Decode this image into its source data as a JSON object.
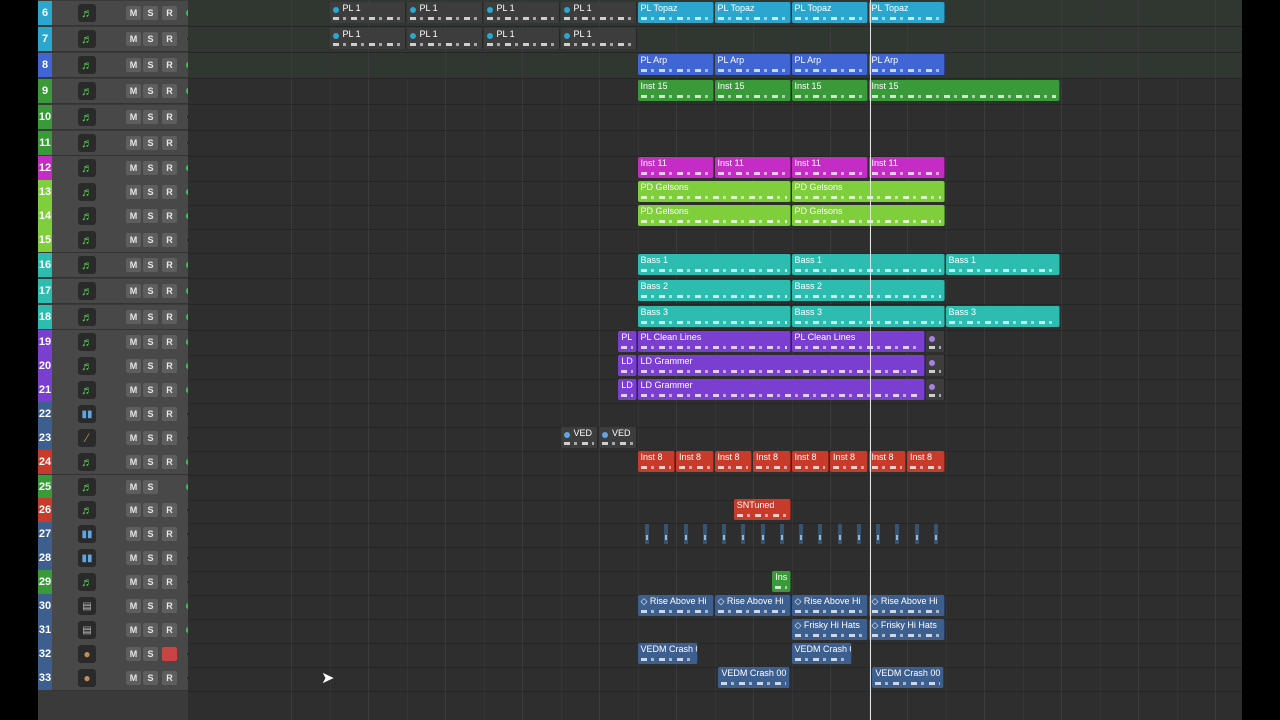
{
  "tracks": [
    {
      "num": "6",
      "color": "#2aa6cf",
      "icon": "music-note-icon",
      "glyph": "♬",
      "m": "M",
      "s": "S",
      "r": "R",
      "led": true
    },
    {
      "num": "7",
      "color": "#2aa6cf",
      "icon": "music-note-icon",
      "glyph": "♬",
      "m": "M",
      "s": "S",
      "r": "R",
      "led": false
    },
    {
      "num": "8",
      "color": "#3f66d4",
      "icon": "music-note-icon",
      "glyph": "♬",
      "m": "M",
      "s": "S",
      "r": "R",
      "led": true
    },
    {
      "num": "9",
      "color": "#3a9a3a",
      "icon": "music-note-icon",
      "glyph": "♬",
      "m": "M",
      "s": "S",
      "r": "R",
      "led": true
    },
    {
      "num": "10",
      "color": "#3a9a3a",
      "icon": "music-note-icon",
      "glyph": "♬",
      "m": "M",
      "s": "S",
      "r": "R",
      "led": false
    },
    {
      "num": "11",
      "color": "#3a9a3a",
      "icon": "music-note-icon",
      "glyph": "♬",
      "m": "M",
      "s": "S",
      "r": "R",
      "led": false
    },
    {
      "num": "12",
      "color": "#c52bc5",
      "icon": "music-note-icon",
      "glyph": "♬",
      "m": "M",
      "s": "S",
      "r": "R",
      "led": true
    },
    {
      "num": "13",
      "color": "#7fcf3c",
      "icon": "music-note-icon",
      "glyph": "♬",
      "m": "M",
      "s": "S",
      "r": "R",
      "led": true
    },
    {
      "num": "14",
      "color": "#7fcf3c",
      "icon": "music-note-icon",
      "glyph": "♬",
      "m": "M",
      "s": "S",
      "r": "R",
      "led": true
    },
    {
      "num": "15",
      "color": "#7fcf3c",
      "icon": "music-note-icon",
      "glyph": "♬",
      "m": "M",
      "s": "S",
      "r": "R",
      "led": false
    },
    {
      "num": "16",
      "color": "#2dbdb0",
      "icon": "music-note-icon",
      "glyph": "♬",
      "m": "M",
      "s": "S",
      "r": "R",
      "led": true
    },
    {
      "num": "17",
      "color": "#2dbdb0",
      "icon": "music-note-icon",
      "glyph": "♬",
      "m": "M",
      "s": "S",
      "r": "R",
      "led": true
    },
    {
      "num": "18",
      "color": "#2dbdb0",
      "icon": "music-note-icon",
      "glyph": "♬",
      "m": "M",
      "s": "S",
      "r": "R",
      "led": true
    },
    {
      "num": "19",
      "color": "#7a3fd1",
      "icon": "music-note-icon",
      "glyph": "♬",
      "m": "M",
      "s": "S",
      "r": "R",
      "led": true
    },
    {
      "num": "20",
      "color": "#7a3fd1",
      "icon": "music-note-icon",
      "glyph": "♬",
      "m": "M",
      "s": "S",
      "r": "R",
      "led": true
    },
    {
      "num": "21",
      "color": "#7a3fd1",
      "icon": "music-note-icon",
      "glyph": "♬",
      "m": "M",
      "s": "S",
      "r": "R",
      "led": true
    },
    {
      "num": "22",
      "color": "#3d5f8f",
      "icon": "waveform-icon",
      "glyph": "▮▮",
      "m": "M",
      "s": "S",
      "r": "R",
      "led": false
    },
    {
      "num": "23",
      "color": "#3d5f8f",
      "icon": "drumstick-icon",
      "glyph": "⁄",
      "m": "M",
      "s": "S",
      "r": "R",
      "led": false
    },
    {
      "num": "24",
      "color": "#c83a2a",
      "icon": "music-note-icon",
      "glyph": "♬",
      "m": "M",
      "s": "S",
      "r": "R",
      "led": true
    },
    {
      "num": "25",
      "color": "#3a9a3a",
      "icon": "music-note-icon",
      "glyph": "♬",
      "m": "M",
      "s": "S",
      "r": "",
      "led": true
    },
    {
      "num": "26",
      "color": "#c83a2a",
      "icon": "music-note-icon",
      "glyph": "♬",
      "m": "M",
      "s": "S",
      "r": "R",
      "led": false
    },
    {
      "num": "27",
      "color": "#3d5f8f",
      "icon": "waveform-icon",
      "glyph": "▮▮",
      "m": "M",
      "s": "S",
      "r": "R",
      "led": false
    },
    {
      "num": "28",
      "color": "#3d5f8f",
      "icon": "waveform-icon",
      "glyph": "▮▮",
      "m": "M",
      "s": "S",
      "r": "R",
      "led": false
    },
    {
      "num": "29",
      "color": "#3a9a3a",
      "icon": "music-note-icon",
      "glyph": "♬",
      "m": "M",
      "s": "S",
      "r": "R",
      "led": false
    },
    {
      "num": "30",
      "color": "#3d5f8f",
      "icon": "folder-icon",
      "glyph": "▤",
      "m": "M",
      "s": "S",
      "r": "R",
      "led": true
    },
    {
      "num": "31",
      "color": "#3d5f8f",
      "icon": "folder-icon",
      "glyph": "▤",
      "m": "M",
      "s": "S",
      "r": "R",
      "led": true
    },
    {
      "num": "32",
      "color": "#3d5f8f",
      "icon": "microphone-icon",
      "glyph": "●",
      "m": "M",
      "s": "S",
      "r": "R",
      "led": false,
      "armed": true
    },
    {
      "num": "33",
      "color": "#3d5f8f",
      "icon": "microphone-icon",
      "glyph": "●",
      "m": "M",
      "s": "S",
      "r": "R",
      "led": false
    }
  ],
  "regions": [
    {
      "track": 0,
      "bar": 1.5,
      "len": 1,
      "label": "PL 1",
      "color": "#3d3d3d",
      "dot": "#2aa6cf"
    },
    {
      "track": 0,
      "bar": 2.5,
      "len": 1,
      "label": "PL 1",
      "color": "#3d3d3d",
      "dot": "#2aa6cf"
    },
    {
      "track": 0,
      "bar": 3.5,
      "len": 1,
      "label": "PL 1",
      "color": "#3d3d3d",
      "dot": "#2aa6cf"
    },
    {
      "track": 0,
      "bar": 4.5,
      "len": 1,
      "label": "PL 1",
      "color": "#3d3d3d",
      "dot": "#2aa6cf"
    },
    {
      "track": 0,
      "bar": 5.5,
      "len": 1,
      "label": "PL Topaz",
      "color": "#2aa6cf"
    },
    {
      "track": 0,
      "bar": 6.5,
      "len": 1,
      "label": "PL Topaz",
      "color": "#2aa6cf"
    },
    {
      "track": 0,
      "bar": 7.5,
      "len": 1,
      "label": "PL Topaz",
      "color": "#2aa6cf"
    },
    {
      "track": 0,
      "bar": 8.5,
      "len": 1,
      "label": "PL Topaz",
      "color": "#2aa6cf"
    },
    {
      "track": 1,
      "bar": 1.5,
      "len": 1,
      "label": "PL 1",
      "color": "#3d3d3d",
      "dot": "#2aa6cf"
    },
    {
      "track": 1,
      "bar": 2.5,
      "len": 1,
      "label": "PL 1",
      "color": "#3d3d3d",
      "dot": "#2aa6cf"
    },
    {
      "track": 1,
      "bar": 3.5,
      "len": 1,
      "label": "PL 1",
      "color": "#3d3d3d",
      "dot": "#2aa6cf"
    },
    {
      "track": 1,
      "bar": 4.5,
      "len": 1,
      "label": "PL 1",
      "color": "#3d3d3d",
      "dot": "#2aa6cf"
    },
    {
      "track": 2,
      "bar": 5.5,
      "len": 1,
      "label": "PL Arp",
      "color": "#3f66d4"
    },
    {
      "track": 2,
      "bar": 6.5,
      "len": 1,
      "label": "PL Arp",
      "color": "#3f66d4"
    },
    {
      "track": 2,
      "bar": 7.5,
      "len": 1,
      "label": "PL Arp",
      "color": "#3f66d4"
    },
    {
      "track": 2,
      "bar": 8.5,
      "len": 1,
      "label": "PL Arp",
      "color": "#3f66d4"
    },
    {
      "track": 3,
      "bar": 5.5,
      "len": 1,
      "label": "Inst 15",
      "color": "#3a9a3a"
    },
    {
      "track": 3,
      "bar": 6.5,
      "len": 1,
      "label": "Inst 15",
      "color": "#3a9a3a"
    },
    {
      "track": 3,
      "bar": 7.5,
      "len": 1,
      "label": "Inst 15",
      "color": "#3a9a3a"
    },
    {
      "track": 3,
      "bar": 8.5,
      "len": 2.5,
      "label": "Inst 15",
      "color": "#3a9a3a"
    },
    {
      "track": 6,
      "bar": 5.5,
      "len": 1,
      "label": "Inst 11",
      "color": "#c52bc5"
    },
    {
      "track": 6,
      "bar": 6.5,
      "len": 1,
      "label": "Inst 11",
      "color": "#c52bc5"
    },
    {
      "track": 6,
      "bar": 7.5,
      "len": 1,
      "label": "Inst 11",
      "color": "#c52bc5"
    },
    {
      "track": 6,
      "bar": 8.5,
      "len": 1,
      "label": "Inst 11",
      "color": "#c52bc5"
    },
    {
      "track": 7,
      "bar": 5.5,
      "len": 2,
      "label": "PD Gelsons",
      "color": "#7fcf3c"
    },
    {
      "track": 7,
      "bar": 7.5,
      "len": 2,
      "label": "PD Gelsons",
      "color": "#7fcf3c"
    },
    {
      "track": 8,
      "bar": 5.5,
      "len": 2,
      "label": "PD Gelsons",
      "color": "#7fcf3c"
    },
    {
      "track": 8,
      "bar": 7.5,
      "len": 2,
      "label": "PD Gelsons",
      "color": "#7fcf3c"
    },
    {
      "track": 10,
      "bar": 5.5,
      "len": 2,
      "label": "Bass 1",
      "color": "#2dbdb0"
    },
    {
      "track": 10,
      "bar": 7.5,
      "len": 2,
      "label": "Bass 1",
      "color": "#2dbdb0"
    },
    {
      "track": 10,
      "bar": 9.5,
      "len": 1.5,
      "label": "Bass 1",
      "color": "#2dbdb0"
    },
    {
      "track": 11,
      "bar": 5.5,
      "len": 2,
      "label": "Bass 2",
      "color": "#2dbdb0"
    },
    {
      "track": 11,
      "bar": 7.5,
      "len": 2,
      "label": "Bass 2",
      "color": "#2dbdb0"
    },
    {
      "track": 12,
      "bar": 5.5,
      "len": 2,
      "label": "Bass 3",
      "color": "#2dbdb0"
    },
    {
      "track": 12,
      "bar": 7.5,
      "len": 2,
      "label": "Bass 3",
      "color": "#2dbdb0"
    },
    {
      "track": 12,
      "bar": 9.5,
      "len": 1.5,
      "label": "Bass 3",
      "color": "#2dbdb0"
    },
    {
      "track": 13,
      "bar": 5.25,
      "len": 0.25,
      "label": "PL",
      "color": "#7a3fd1"
    },
    {
      "track": 13,
      "bar": 5.5,
      "len": 2,
      "label": "PL Clean Lines",
      "color": "#7a3fd1"
    },
    {
      "track": 13,
      "bar": 7.5,
      "len": 1.75,
      "label": "PL Clean Lines",
      "color": "#7a3fd1"
    },
    {
      "track": 13,
      "bar": 9.25,
      "len": 0.25,
      "label": "",
      "color": "#3d3d3d",
      "dot": "#a97ee8"
    },
    {
      "track": 14,
      "bar": 5.25,
      "len": 0.25,
      "label": "LD",
      "color": "#7a3fd1"
    },
    {
      "track": 14,
      "bar": 5.5,
      "len": 3.75,
      "label": "LD Grammer",
      "color": "#7a3fd1"
    },
    {
      "track": 14,
      "bar": 9.25,
      "len": 0.25,
      "label": "",
      "color": "#3d3d3d",
      "dot": "#a97ee8"
    },
    {
      "track": 15,
      "bar": 5.25,
      "len": 0.25,
      "label": "LD",
      "color": "#7a3fd1"
    },
    {
      "track": 15,
      "bar": 5.5,
      "len": 3.75,
      "label": "LD Grammer",
      "color": "#7a3fd1"
    },
    {
      "track": 15,
      "bar": 9.25,
      "len": 0.25,
      "label": "",
      "color": "#3d3d3d",
      "dot": "#a97ee8"
    },
    {
      "track": 17,
      "bar": 4.5,
      "len": 0.5,
      "label": "VED",
      "color": "#3d3d3d",
      "dot": "#5fa6e6"
    },
    {
      "track": 17,
      "bar": 5.0,
      "len": 0.5,
      "label": "VED",
      "color": "#3d3d3d",
      "dot": "#5fa6e6"
    },
    {
      "track": 18,
      "bar": 5.5,
      "len": 0.5,
      "label": "Inst 8",
      "color": "#c83a2a"
    },
    {
      "track": 18,
      "bar": 6.0,
      "len": 0.5,
      "label": "Inst 8",
      "color": "#c83a2a"
    },
    {
      "track": 18,
      "bar": 6.5,
      "len": 0.5,
      "label": "Inst 8",
      "color": "#c83a2a"
    },
    {
      "track": 18,
      "bar": 7.0,
      "len": 0.5,
      "label": "Inst 8",
      "color": "#c83a2a"
    },
    {
      "track": 18,
      "bar": 7.5,
      "len": 0.5,
      "label": "Inst 8",
      "color": "#c83a2a"
    },
    {
      "track": 18,
      "bar": 8.0,
      "len": 0.5,
      "label": "Inst 8",
      "color": "#c83a2a"
    },
    {
      "track": 18,
      "bar": 8.5,
      "len": 0.5,
      "label": "Inst 8",
      "color": "#c83a2a"
    },
    {
      "track": 18,
      "bar": 9.0,
      "len": 0.5,
      "label": "Inst 8",
      "color": "#c83a2a"
    },
    {
      "track": 20,
      "bar": 6.75,
      "len": 0.75,
      "label": "SNTuned",
      "color": "#c83a2a"
    },
    {
      "track": 23,
      "bar": 7.25,
      "len": 0.25,
      "label": "Ins",
      "color": "#3a9a3a"
    },
    {
      "track": 24,
      "bar": 5.5,
      "len": 1,
      "label": "◇ Rise Above Hi",
      "color": "#3d5f8f"
    },
    {
      "track": 24,
      "bar": 6.5,
      "len": 1,
      "label": "◇ Rise Above Hi",
      "color": "#3d5f8f"
    },
    {
      "track": 24,
      "bar": 7.5,
      "len": 1,
      "label": "◇ Rise Above Hi",
      "color": "#3d5f8f"
    },
    {
      "track": 24,
      "bar": 8.5,
      "len": 1,
      "label": "◇ Rise Above Hi",
      "color": "#3d5f8f"
    },
    {
      "track": 25,
      "bar": 7.5,
      "len": 1,
      "label": "◇ Frisky Hi Hats",
      "color": "#3d5f8f"
    },
    {
      "track": 25,
      "bar": 8.5,
      "len": 1,
      "label": "◇ Frisky Hi Hats",
      "color": "#3d5f8f"
    },
    {
      "track": 26,
      "bar": 5.5,
      "len": 0.8,
      "label": "VEDM Crash 0",
      "color": "#3d5f8f"
    },
    {
      "track": 26,
      "bar": 7.5,
      "len": 0.8,
      "label": "VEDM Crash 0",
      "color": "#3d5f8f"
    },
    {
      "track": 27,
      "bar": 6.55,
      "len": 0.95,
      "label": "VEDM Crash 00",
      "color": "#3d5f8f"
    },
    {
      "track": 27,
      "bar": 8.55,
      "len": 0.95,
      "label": "VEDM Crash 00",
      "color": "#3d5f8f"
    }
  ],
  "audio_slices": {
    "track": 21,
    "start_bar": 5.6,
    "count": 16,
    "step_bars": 0.25
  },
  "playhead_bar": 8.52
}
